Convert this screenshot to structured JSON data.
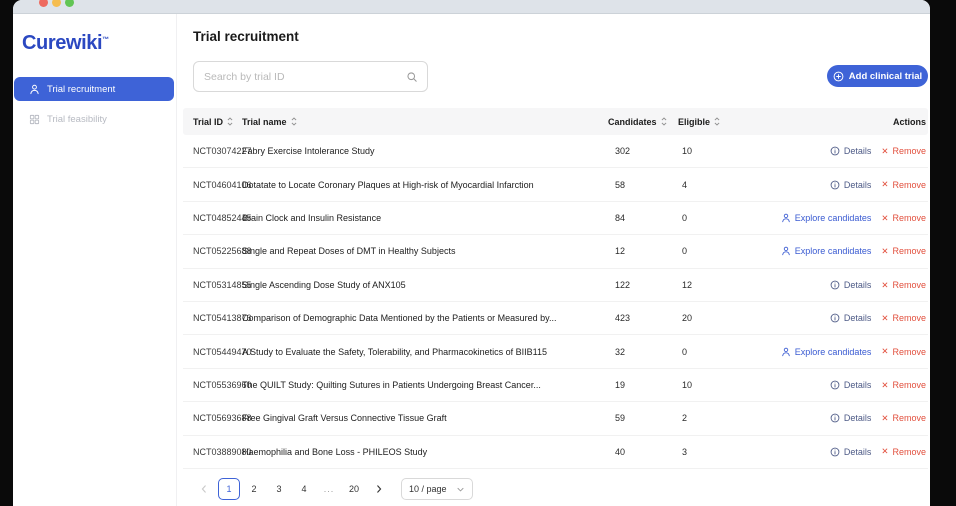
{
  "window": {
    "traffic_lights": [
      "close",
      "minimize",
      "zoom"
    ]
  },
  "colors": {
    "brand": "#2b48c1",
    "primary_blue": "#3e63d7",
    "explore_link": "#3a5bd2",
    "details_link": "#4d5a86",
    "remove_red": "#e2503e",
    "header_band": "#f6f6f7",
    "traffic_red": "#ee6a5f",
    "traffic_yellow": "#f5bd4f",
    "traffic_green": "#62c554"
  },
  "sidebar": {
    "logo": "Curewiki",
    "logo_tm": "™",
    "items": [
      {
        "label": "Trial recruitment",
        "icon": "user-icon",
        "active": true
      },
      {
        "label": "Trial feasibility",
        "icon": "grid-icon",
        "active": false
      }
    ]
  },
  "main": {
    "title": "Trial recruitment",
    "search": {
      "placeholder": "Search by trial ID"
    },
    "add_button": {
      "label": "Add clinical trial"
    },
    "table": {
      "columns": [
        {
          "label": "Trial ID",
          "sortable": true
        },
        {
          "label": "Trial name",
          "sortable": true
        },
        {
          "label": "Candidates",
          "sortable": true
        },
        {
          "label": "Eligible",
          "sortable": true
        },
        {
          "label": "Actions",
          "sortable": false
        }
      ],
      "details_label": "Details",
      "explore_label": "Explore candidates",
      "remove_label": "Remove",
      "rows": [
        {
          "id": "NCT03074227",
          "name": "Fabry Exercise Intolerance Study",
          "candidates": "302",
          "eligible": "10",
          "action": "Details"
        },
        {
          "id": "NCT04604106",
          "name": "Dotatate to Locate Coronary Plaques at High-risk of Myocardial Infarction",
          "candidates": "58",
          "eligible": "4",
          "action": "Details"
        },
        {
          "id": "NCT04852445",
          "name": "Brain Clock and Insulin Resistance",
          "candidates": "84",
          "eligible": "0",
          "action": "Explore candidates"
        },
        {
          "id": "NCT05225688",
          "name": "Single and Repeat Doses of DMT in Healthy Subjects",
          "candidates": "12",
          "eligible": "0",
          "action": "Explore candidates"
        },
        {
          "id": "NCT05314855",
          "name": "Single Ascending Dose Study of ANX105",
          "candidates": "122",
          "eligible": "12",
          "action": "Details"
        },
        {
          "id": "NCT05413876",
          "name": "Comparison of Demographic Data Mentioned by the Patients or Measured by...",
          "candidates": "423",
          "eligible": "20",
          "action": "Details"
        },
        {
          "id": "NCT05449470",
          "name": "A Study to Evaluate the Safety, Tolerability, and Pharmacokinetics of BIIB115",
          "candidates": "32",
          "eligible": "0",
          "action": "Explore candidates"
        },
        {
          "id": "NCT05536960",
          "name": "The QUILT Study: Quilting Sutures in Patients Undergoing Breast Cancer...",
          "candidates": "19",
          "eligible": "10",
          "action": "Details"
        },
        {
          "id": "NCT05693688",
          "name": "Free Gingival Graft Versus Connective Tissue Graft",
          "candidates": "59",
          "eligible": "2",
          "action": "Details"
        },
        {
          "id": "NCT03889080",
          "name": "Haemophilia and Bone Loss - PHILEOS Study",
          "candidates": "40",
          "eligible": "3",
          "action": "Details"
        }
      ]
    },
    "pagination": {
      "pages": [
        "1",
        "2",
        "3",
        "4",
        "...",
        "20"
      ],
      "active": "1",
      "page_size": "10 / page"
    }
  }
}
